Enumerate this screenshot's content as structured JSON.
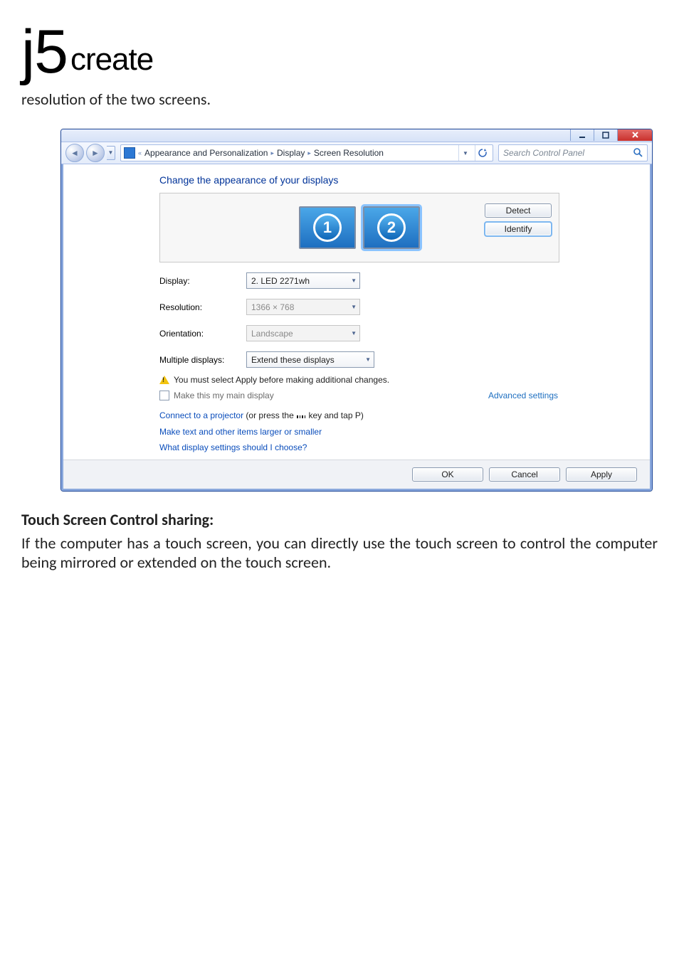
{
  "brand": {
    "j5": "j5",
    "create": "create"
  },
  "doc": {
    "intro": "resolution of the two screens.",
    "touch_heading": "Touch Screen Control sharing:",
    "touch_body": "If the computer has a touch screen, you can directly use the touch screen to control the computer being mirrored or extended on the touch screen."
  },
  "win": {
    "breadcrumb": {
      "chev": "«",
      "a": "Appearance and Personalization",
      "b": "Display",
      "c": "Screen Resolution",
      "sep": "▸"
    },
    "search_placeholder": "Search Control Panel",
    "heading": "Change the appearance of your displays",
    "monitors": {
      "one": "1",
      "two": "2"
    },
    "btn_detect": "Detect",
    "btn_identify": "Identify",
    "labels": {
      "display": "Display:",
      "resolution": "Resolution:",
      "orientation": "Orientation:",
      "multiple": "Multiple displays:"
    },
    "values": {
      "display": "2. LED 2271wh",
      "resolution": "1366 × 768",
      "orientation": "Landscape",
      "multiple": "Extend these displays"
    },
    "warn_text": "You must select Apply before making additional changes.",
    "chk_main": "Make this my main display",
    "adv_link": "Advanced settings",
    "link_projector_a": "Connect to a projector",
    "link_projector_b": " (or press the ",
    "link_projector_c": " key and tap P)",
    "link_textsize": "Make text and other items larger or smaller",
    "link_help": "What display settings should I choose?",
    "btn_ok": "OK",
    "btn_cancel": "Cancel",
    "btn_apply": "Apply"
  }
}
